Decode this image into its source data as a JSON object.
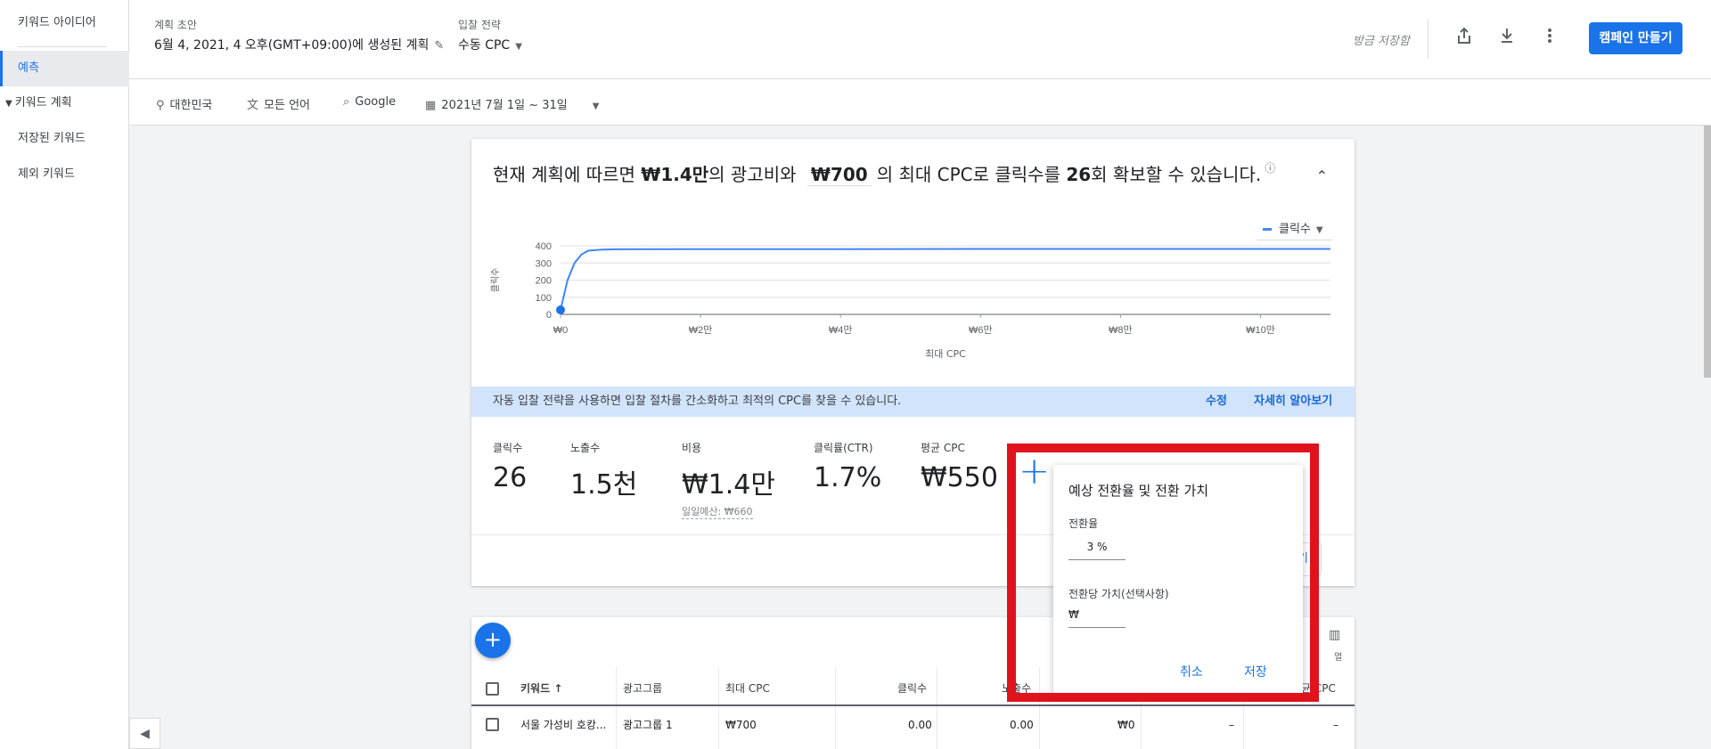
{
  "sidebar": {
    "items": [
      {
        "label": "키워드 아이디어"
      },
      {
        "label": "예측"
      },
      {
        "label": "키워드 계획"
      },
      {
        "label": "저장된 키워드"
      },
      {
        "label": "제외 키워드"
      }
    ]
  },
  "header": {
    "plan_label": "계획 초안",
    "plan_title": "6월 4, 2021, 4 오후(GMT+09:00)에 생성된 계획",
    "bid_label": "입찰 전략",
    "bid_value": "수동 CPC",
    "saved_status": "방금 저장함",
    "create_campaign": "캠페인 만들기"
  },
  "filters": {
    "location": "대한민국",
    "language": "모든 언어",
    "network": "Google",
    "date_range": "2021년 7월 1일 ~ 31일"
  },
  "summary": {
    "prefix": "현재 계획에 따르면",
    "budget": "₩1.4만",
    "mid1": "의 광고비와",
    "max_cpc": "₩700",
    "mid2": "의 최대 CPC로 클릭수를",
    "clicks": "26",
    "suffix": "회 확보할 수 있습니다."
  },
  "legend": {
    "metric": "클릭수"
  },
  "chart_data": {
    "type": "line",
    "xlabel": "최대 CPC",
    "ylabel": "클릭수",
    "ylim": [
      0,
      400
    ],
    "yticks": [
      "400",
      "300",
      "200",
      "100",
      "0"
    ],
    "xticks": [
      "₩0",
      "₩2만",
      "₩4만",
      "₩6만",
      "₩8만",
      "₩10만"
    ],
    "x": [
      0,
      1000,
      2000,
      3000,
      4000,
      6000,
      8000,
      20000,
      40000,
      60000,
      80000,
      100000,
      110000
    ],
    "series": [
      {
        "values": [
          26,
          200,
          300,
          350,
          372,
          378,
          380,
          381,
          381,
          382,
          382,
          382,
          382
        ]
      }
    ],
    "marker_index": 0,
    "line_color": "#4285f4"
  },
  "banner": {
    "text": "자동 입찰 전략을 사용하면 입찰 절차를 간소화하고 최적의 CPC를 찾을 수 있습니다.",
    "edit_link": "수정",
    "learn_link": "자세히 알아보기"
  },
  "metrics": [
    {
      "label": "클릭수",
      "value": "26"
    },
    {
      "label": "노출수",
      "value": "1.5천"
    },
    {
      "label": "비용",
      "value": "₩1.4만",
      "sub": "일일예산: ₩660"
    },
    {
      "label": "클릭률(CTR)",
      "value": "1.7%"
    },
    {
      "label": "평균 CPC",
      "value": "₩550"
    }
  ],
  "ghost_button": "하기",
  "table": {
    "columns_label": "열",
    "headers": [
      "키워드",
      "광고그룹",
      "최대 CPC",
      "클릭수",
      "노출수",
      "",
      "",
      "평균 CPC"
    ],
    "row": {
      "keyword": "서울 가성비 호캉...",
      "ad_group": "광고그룹 1",
      "max_cpc": "₩700",
      "clicks": "0.00",
      "impressions": "0.00",
      "cost": "₩0",
      "ctr": "–",
      "avg_cpc": "–"
    }
  },
  "popup": {
    "title": "예상 전환율 및 전환 가치",
    "conv_rate_label": "전환율",
    "conv_rate_value": "3",
    "conv_rate_unit": "%",
    "conv_value_label": "전환당 가치(선택사항)",
    "currency": "₩",
    "cancel": "취소",
    "save": "저장"
  },
  "colors": {
    "accent": "#1a73e8",
    "highlight": "#e0121c"
  }
}
